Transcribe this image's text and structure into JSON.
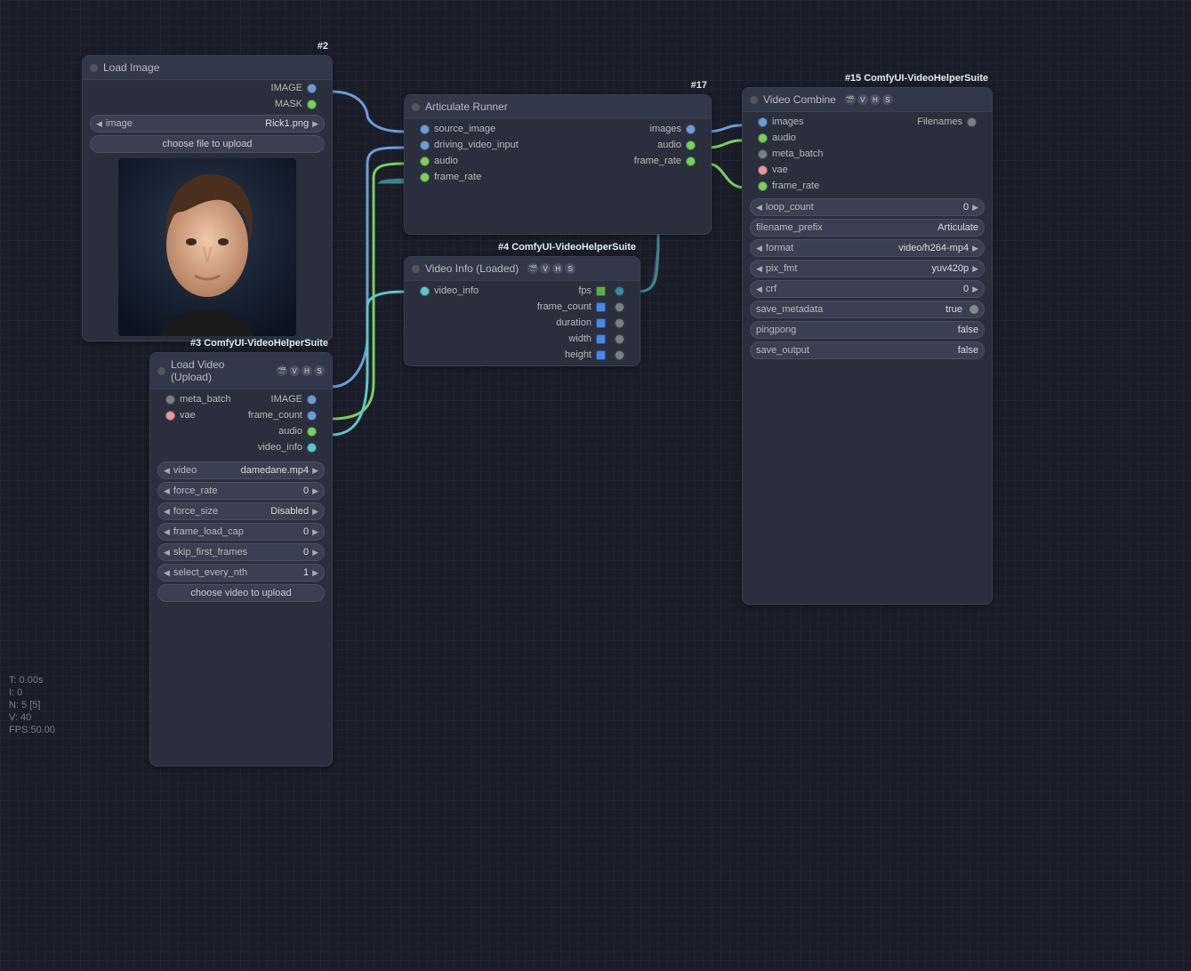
{
  "stats": {
    "t": "T: 0.00s",
    "i": "I: 0",
    "n": "N: 5 [5]",
    "v": "V: 40",
    "fps": "FPS:50.00"
  },
  "node2": {
    "badge": "#2",
    "title": "Load Image",
    "out_image": "IMAGE",
    "out_mask": "MASK",
    "w_image_label": "image",
    "w_image_value": "Rick1.png",
    "btn_upload": "choose file to upload"
  },
  "node3": {
    "badge": "#3 ComfyUI-VideoHelperSuite",
    "title": "Load Video (Upload)",
    "in_meta": "meta_batch",
    "in_vae": "vae",
    "out_image": "IMAGE",
    "out_frame_count": "frame_count",
    "out_audio": "audio",
    "out_video_info": "video_info",
    "w_video_label": "video",
    "w_video_value": "damedane.mp4",
    "w_force_rate_label": "force_rate",
    "w_force_rate_value": "0",
    "w_force_size_label": "force_size",
    "w_force_size_value": "Disabled",
    "w_frame_cap_label": "frame_load_cap",
    "w_frame_cap_value": "0",
    "w_skip_label": "skip_first_frames",
    "w_skip_value": "0",
    "w_select_label": "select_every_nth",
    "w_select_value": "1",
    "btn_upload": "choose video to upload"
  },
  "node4": {
    "badge": "#4 ComfyUI-VideoHelperSuite",
    "title": "Video Info (Loaded)",
    "in_video_info": "video_info",
    "out_fps": "fps",
    "out_frame_count": "frame_count",
    "out_duration": "duration",
    "out_width": "width",
    "out_height": "height"
  },
  "node17": {
    "badge": "#17",
    "title": "Articulate Runner",
    "in_source": "source_image",
    "in_driving": "driving_video_input",
    "in_audio": "audio",
    "in_frame_rate": "frame_rate",
    "out_images": "images",
    "out_audio": "audio",
    "out_frame_rate": "frame_rate"
  },
  "node15": {
    "badge": "#15 ComfyUI-VideoHelperSuite",
    "title": "Video Combine",
    "in_images": "images",
    "in_audio": "audio",
    "in_meta": "meta_batch",
    "in_vae": "vae",
    "in_frame_rate": "frame_rate",
    "out_filenames": "Filenames",
    "w_loop_label": "loop_count",
    "w_loop_value": "0",
    "w_prefix_label": "filename_prefix",
    "w_prefix_value": "Articulate",
    "w_format_label": "format",
    "w_format_value": "video/h264-mp4",
    "w_pix_label": "pix_fmt",
    "w_pix_value": "yuv420p",
    "w_crf_label": "crf",
    "w_crf_value": "0",
    "w_savemeta_label": "save_metadata",
    "w_savemeta_value": "true",
    "w_pingpong_label": "pingpong",
    "w_pingpong_value": "false",
    "w_saveout_label": "save_output",
    "w_saveout_value": "false"
  }
}
